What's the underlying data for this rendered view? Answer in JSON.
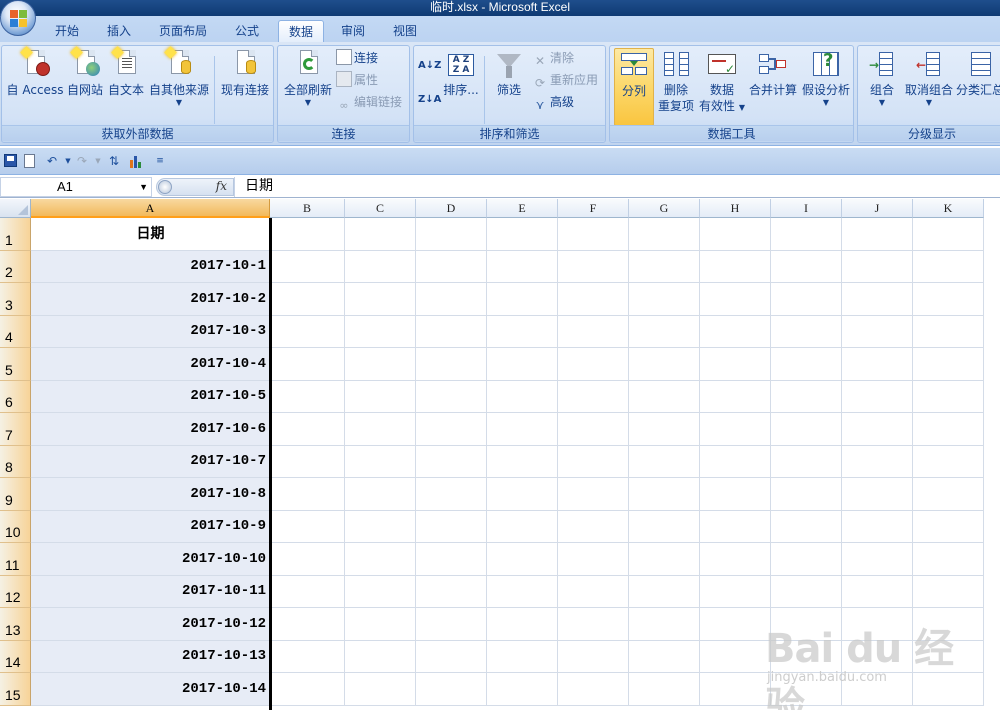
{
  "window": {
    "title": "临时.xlsx - Microsoft Excel"
  },
  "tabs": [
    "开始",
    "插入",
    "页面布局",
    "公式",
    "数据",
    "审阅",
    "视图"
  ],
  "active_tab": "数据",
  "ribbon": {
    "get_external": {
      "label": "获取外部数据",
      "access": "自 Access",
      "web": "自网站",
      "text": "自文本",
      "other": "自其他来源",
      "existing": "现有连接"
    },
    "connections": {
      "label": "连接",
      "refresh_all": "全部刷新",
      "connections": "连接",
      "properties": "属性",
      "edit_links": "编辑链接"
    },
    "sort_filter": {
      "label": "排序和筛选",
      "sort_az": "A↓Z",
      "sort_za": "Z↓A",
      "sort": "排序...",
      "filter": "筛选",
      "clear": "清除",
      "reapply": "重新应用",
      "advanced": "高级"
    },
    "data_tools": {
      "label": "数据工具",
      "text_to_columns": "分列",
      "remove_dup_1": "删除",
      "remove_dup_2": "重复项",
      "validation_1": "数据",
      "validation_2": "有效性",
      "consolidate": "合并计算",
      "whatif": "假设分析"
    },
    "outline": {
      "label": "分级显示",
      "group": "组合",
      "ungroup": "取消组合",
      "subtotal": "分类汇总"
    }
  },
  "formula_bar": {
    "name_box": "A1",
    "fx": "fx",
    "content": "日期"
  },
  "columns": [
    "A",
    "B",
    "C",
    "D",
    "E",
    "F",
    "G",
    "H",
    "I",
    "J",
    "K"
  ],
  "rows": [
    "1",
    "2",
    "3",
    "4",
    "5",
    "6",
    "7",
    "8",
    "9",
    "10",
    "11",
    "12",
    "13",
    "14",
    "15"
  ],
  "cells_a": [
    "日期",
    "2017-10-1",
    "2017-10-2",
    "2017-10-3",
    "2017-10-4",
    "2017-10-5",
    "2017-10-6",
    "2017-10-7",
    "2017-10-8",
    "2017-10-9",
    "2017-10-10",
    "2017-10-11",
    "2017-10-12",
    "2017-10-13",
    "2017-10-14"
  ],
  "watermark": {
    "brand": "Bai du 经验",
    "url": "jingyan.baidu.com"
  }
}
